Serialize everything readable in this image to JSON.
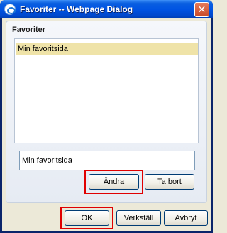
{
  "window": {
    "title": "Favoriter -- Webpage Dialog",
    "close_glyph": "✕"
  },
  "panel": {
    "section_title": "Favoriter",
    "list_items": [
      "Min favoritsida"
    ],
    "name_value": "Min favoritsida",
    "edit_label": "Ändra",
    "remove_label": "Ta bort"
  },
  "footer": {
    "ok_label": "OK",
    "apply_label": "Verkställ",
    "cancel_label": "Avbryt"
  }
}
